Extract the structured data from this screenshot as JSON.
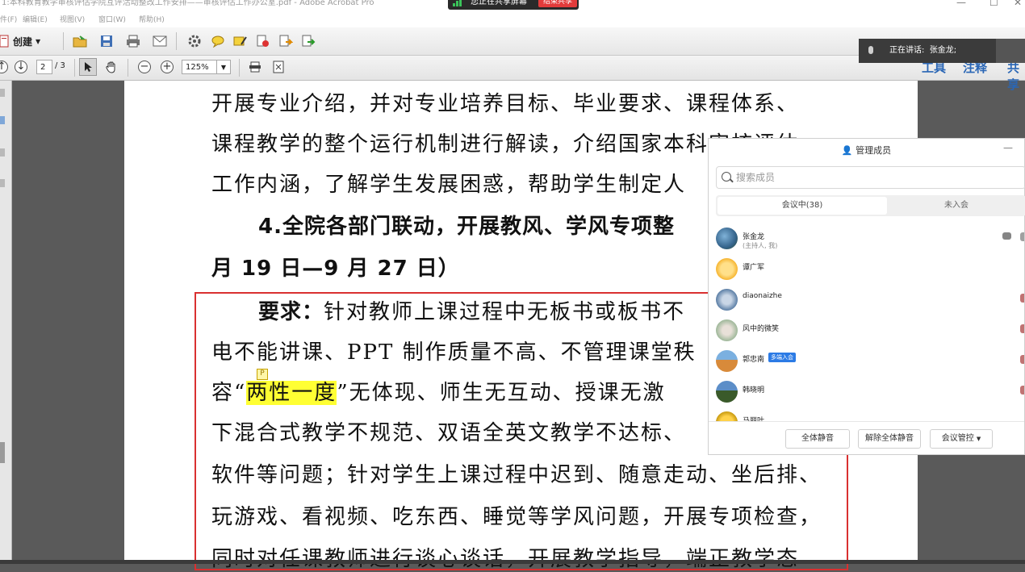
{
  "window": {
    "title": "1:本科教育教学审核评估学院互评活动整改工作安排——审核评估工作办公室.pdf - Adobe Acrobat Pro",
    "sharing_label": "您正在共享屏幕",
    "end_share_label": "结束共享"
  },
  "menu": [
    "件(F)",
    "编辑(E)",
    "视图(V)",
    "窗口(W)",
    "帮助(H)"
  ],
  "toolbar": {
    "create_label": "创建",
    "page_current": "2",
    "page_total": "/ 3",
    "zoom": "125%",
    "right_tabs": [
      "工具",
      "注释",
      "共享"
    ]
  },
  "speaking": {
    "label": "正在讲话:",
    "name": "张金龙;"
  },
  "document": {
    "lines": [
      "开展专业介绍，并对专业培养目标、毕业要求、课程体系、",
      "课程教学的整个运行机制进行解读，介绍国家本科审核评估",
      "工作内涵，了解学生发展困惑，帮助学生制定人",
      "4.全院各部门联动，开展教风、学风专项整",
      "月 19 日—9 月 27 日）"
    ],
    "req_label": "要求：",
    "req_line1_rest": "针对教师上课过程中无板书或板书不",
    "line7": "电不能讲课、PPT 制作质量不高、不管理课堂秩",
    "line8_pre": "容“",
    "line8_hl": "两性一度",
    "line8_post": "”无体现、师生无互动、授课无激",
    "line9": "下混合式教学不规范、双语全英文教学不达标、",
    "line10": "软件等问题；针对学生上课过程中迟到、随意走动、坐后排、",
    "line11": "玩游戏、看视频、吃东西、睡觉等学风问题，开展专项检查，",
    "line12": "同时对任课教师进行谈心谈话，开展教学指导，端正教学态"
  },
  "members_panel": {
    "title": "管理成员",
    "search_placeholder": "搜索成员",
    "tab_in_meeting": "会议中(38)",
    "tab_not_joined": "未入会",
    "members": [
      {
        "name": "张金龙",
        "sub": "(主持人, 我)",
        "badge": ""
      },
      {
        "name": "谭广军",
        "sub": "",
        "badge": ""
      },
      {
        "name": "diaonaizhe",
        "sub": "",
        "badge": ""
      },
      {
        "name": "风中的微笑",
        "sub": "",
        "badge": ""
      },
      {
        "name": "郭忠南",
        "sub": "",
        "badge": "多端入会"
      },
      {
        "name": "韩晓明",
        "sub": "",
        "badge": ""
      },
      {
        "name": "马丽叶",
        "sub": "",
        "badge": ""
      }
    ],
    "btn_mute_all": "全体静音",
    "btn_unmute_all": "解除全体静音",
    "btn_meeting_control": "会议管控"
  }
}
